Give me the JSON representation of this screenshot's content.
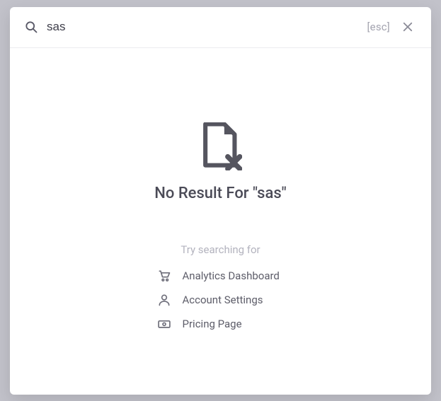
{
  "search": {
    "value": "sas",
    "placeholder": "",
    "esc_label": "[esc]"
  },
  "empty": {
    "title": "No Result For \"sas\"",
    "try_label": "Try searching for"
  },
  "suggestions": [
    {
      "icon": "cart-icon",
      "label": "Analytics Dashboard"
    },
    {
      "icon": "user-icon",
      "label": "Account Settings"
    },
    {
      "icon": "money-icon",
      "label": "Pricing Page"
    }
  ]
}
